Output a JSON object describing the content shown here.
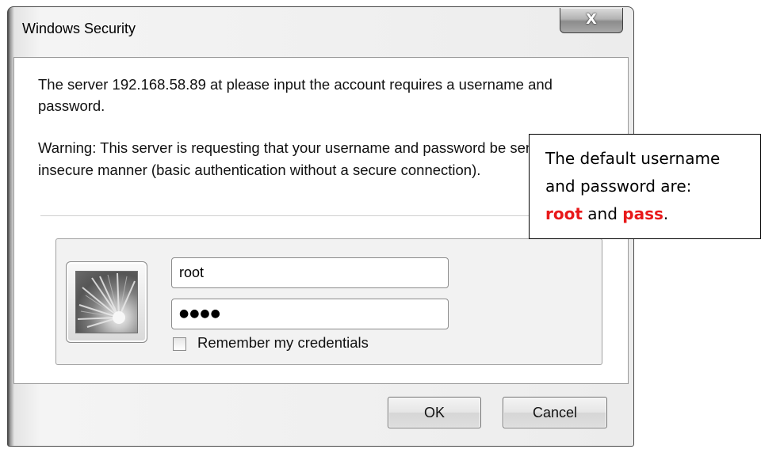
{
  "window": {
    "title": "Windows Security",
    "close_glyph": "X"
  },
  "dialog": {
    "message": "The server 192.168.58.89 at please input the account requires a username and password.",
    "warning": "Warning: This server is requesting that your username and password be sent in an insecure manner (basic authentication without a secure connection).",
    "username_value": "root",
    "password_masked": "●●●●",
    "remember_label": "Remember my credentials",
    "remember_checked": false,
    "ok_label": "OK",
    "cancel_label": "Cancel"
  },
  "annotation": {
    "line1": "The default username",
    "line2": "and password are:",
    "username": "root",
    "and": "and",
    "password": "pass",
    "period": ".",
    "highlight_color": "#e8191a"
  },
  "icons": {
    "close": "close-icon",
    "user_tile": "user-tile-icon",
    "checkbox": "checkbox-icon"
  }
}
